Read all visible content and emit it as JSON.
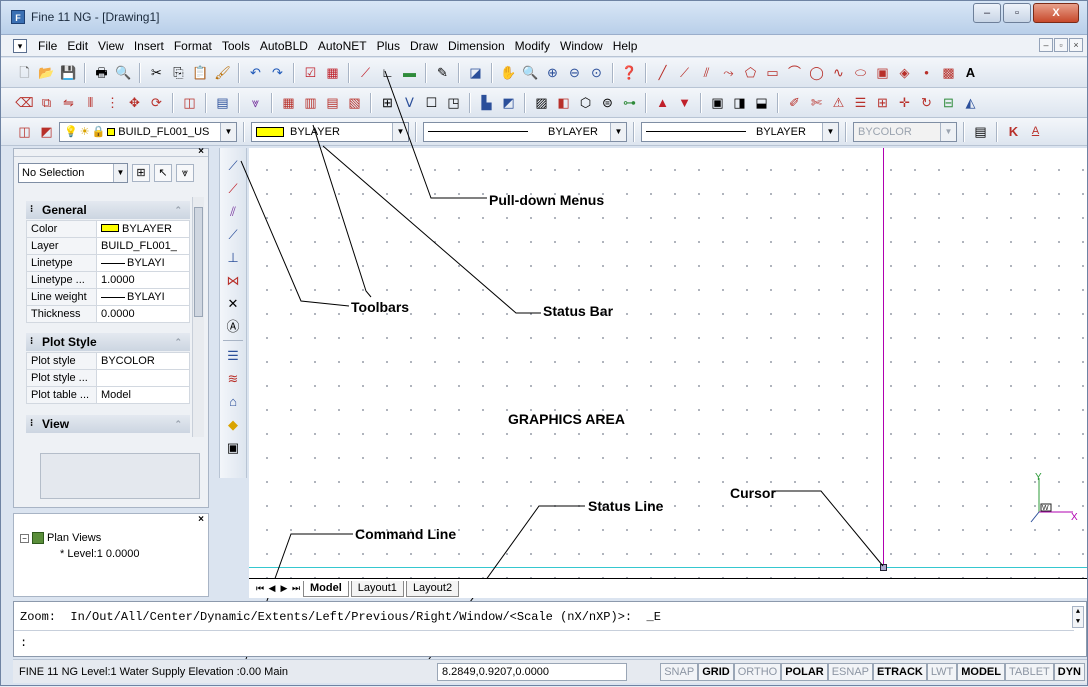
{
  "window": {
    "title": "Fine 11 NG  - [Drawing1]",
    "controls": [
      "–",
      "▫",
      "X"
    ]
  },
  "menubar": {
    "items": [
      "File",
      "Edit",
      "View",
      "Insert",
      "Format",
      "Tools",
      "AutoBLD",
      "AutoNET",
      "Plus",
      "Draw",
      "Dimension",
      "Modify",
      "Window",
      "Help"
    ],
    "mdi_controls": [
      "–",
      "▫",
      "×"
    ]
  },
  "toolbar3": {
    "layer_name": "BUILD_FL001_US",
    "color": "BYLAYER",
    "linetype": "BYLAYER",
    "lineweight": "BYLAYER",
    "plotstyle": "BYCOLOR",
    "text_style_icon": "K"
  },
  "properties_panel": {
    "selection": "No Selection",
    "general_header": "General",
    "general": [
      {
        "key": "Color",
        "value": "BYLAYER",
        "swatch": true
      },
      {
        "key": "Layer",
        "value": "BUILD_FL001_"
      },
      {
        "key": "Linetype",
        "value": "BYLAYI",
        "line": true
      },
      {
        "key": "Linetype ...",
        "value": "1.0000"
      },
      {
        "key": "Line weight",
        "value": "BYLAYI",
        "line": true
      },
      {
        "key": "Thickness",
        "value": "0.0000"
      }
    ],
    "plot_header": "Plot Style",
    "plot": [
      {
        "key": "Plot style",
        "value": "BYCOLOR"
      },
      {
        "key": "Plot style ...",
        "value": ""
      },
      {
        "key": "Plot table ...",
        "value": "Model"
      }
    ],
    "view_header": "View"
  },
  "plan_views": {
    "root": "Plan Views",
    "level": "* Level:1  0.0000"
  },
  "annotations": {
    "pulldown": "Pull-down Menus",
    "toolbars": "Toolbars",
    "statusbar": "Status Bar",
    "graphics": "GRAPHICS AREA",
    "cursor": "Cursor",
    "statusline": "Status Line",
    "commandline": "Command Line"
  },
  "ucs": {
    "y": "Y",
    "x": "X",
    "w": "W"
  },
  "tabs": [
    "Model",
    "Layout1",
    "Layout2"
  ],
  "command": {
    "line1": "Zoom:  In/Out/All/Center/Dynamic/Extents/Left/Previous/Right/Window/<Scale (nX/nXP)>:  _E",
    "line2": ":"
  },
  "statusbar": {
    "text": "FINE 11 NG Level:1  Water Supply Elevation :0.00 Main",
    "coords": "8.2849,0.9207,0.0000",
    "toggles": [
      {
        "label": "SNAP",
        "on": false
      },
      {
        "label": "GRID",
        "on": true
      },
      {
        "label": "ORTHO",
        "on": false
      },
      {
        "label": "POLAR",
        "on": true
      },
      {
        "label": "ESNAP",
        "on": false
      },
      {
        "label": "ETRACK",
        "on": true
      },
      {
        "label": "LWT",
        "on": false
      },
      {
        "label": "MODEL",
        "on": true
      },
      {
        "label": "TABLET",
        "on": false
      },
      {
        "label": "DYN",
        "on": true
      }
    ]
  },
  "colors": {
    "cursor_vertical": "#b000b0",
    "cursor_horizontal": "#35c7cf",
    "layer_swatch": "#ffff00"
  }
}
